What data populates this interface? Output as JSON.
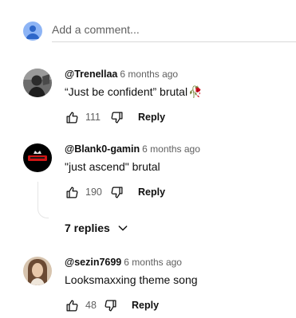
{
  "add_comment": {
    "placeholder": "Add a comment..."
  },
  "comments": [
    {
      "author": "@Trenellaa",
      "time": "6 months ago",
      "text": "“Just be confident” brutal",
      "emoji": "🥀",
      "likes": "111",
      "reply_label": "Reply"
    },
    {
      "author": "@Blank0-gamin",
      "time": "6 months ago",
      "text": "\"just ascend\" brutal",
      "likes": "190",
      "reply_label": "Reply",
      "replies_label": "7 replies"
    },
    {
      "author": "@sezin7699",
      "time": "6 months ago",
      "text": "Looksmaxxing theme song",
      "likes": "48",
      "reply_label": "Reply"
    }
  ],
  "colors": {
    "text_primary": "#0f0f0f",
    "text_secondary": "#606060",
    "my_avatar": "#8db4f5",
    "divider": "#d9d9d9"
  },
  "icons": [
    "user-avatar-icon",
    "thumbs-up-icon",
    "thumbs-down-icon",
    "chevron-down-icon"
  ]
}
